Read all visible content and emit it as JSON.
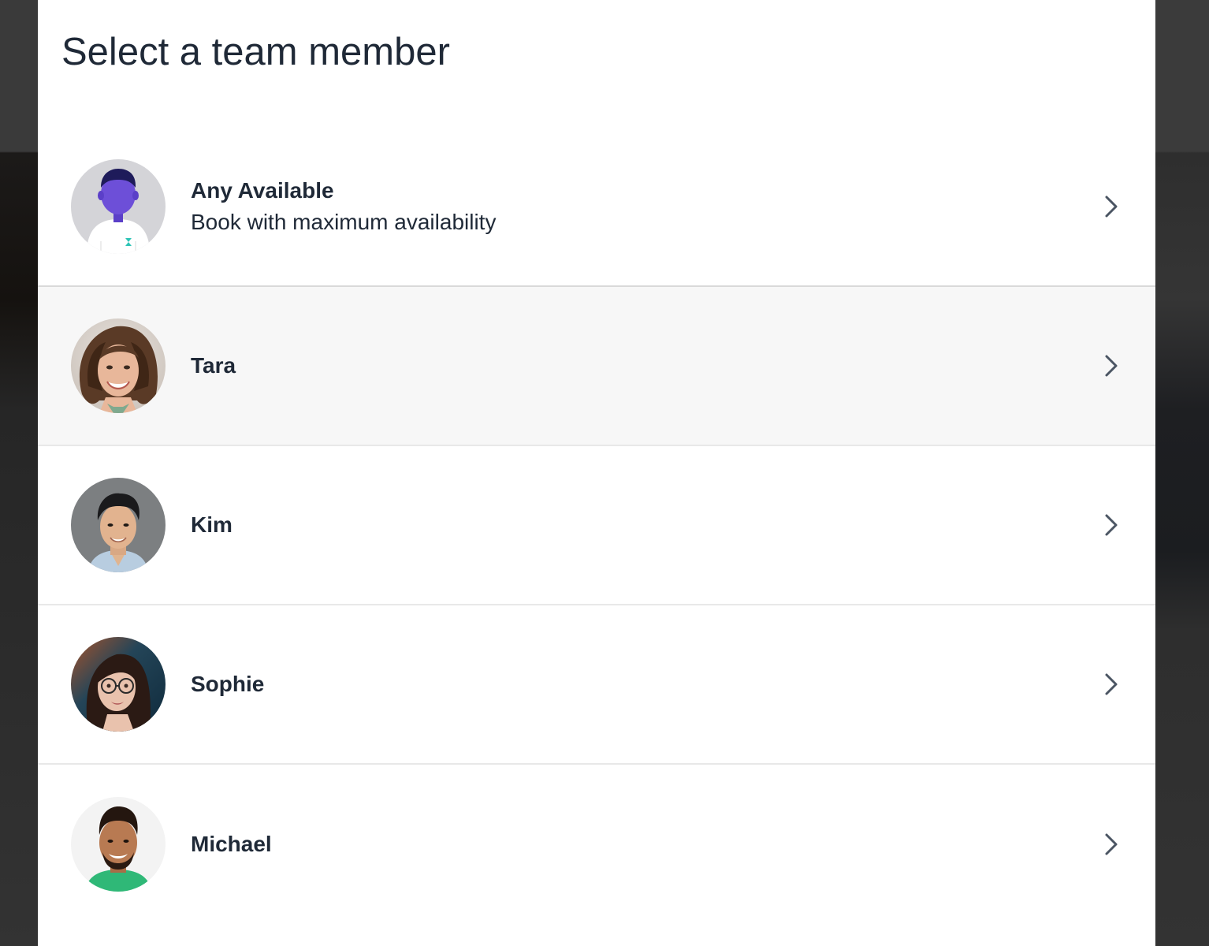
{
  "page": {
    "title": "Select a team member"
  },
  "members": [
    {
      "name": "Any Available",
      "subtitle": "Book with maximum availability"
    },
    {
      "name": "Tara",
      "subtitle": ""
    },
    {
      "name": "Kim",
      "subtitle": ""
    },
    {
      "name": "Sophie",
      "subtitle": ""
    },
    {
      "name": "Michael",
      "subtitle": ""
    }
  ],
  "colors": {
    "text": "#1f2937",
    "hover_row": "#f7f7f7",
    "divider": "#e8e8e8",
    "chevron": "#4b5563",
    "placeholder_avatar_bg": "#d4d4d8",
    "placeholder_figure": "#6d4fd8"
  },
  "icons": [
    "chevron-right-icon",
    "person-placeholder-icon"
  ]
}
